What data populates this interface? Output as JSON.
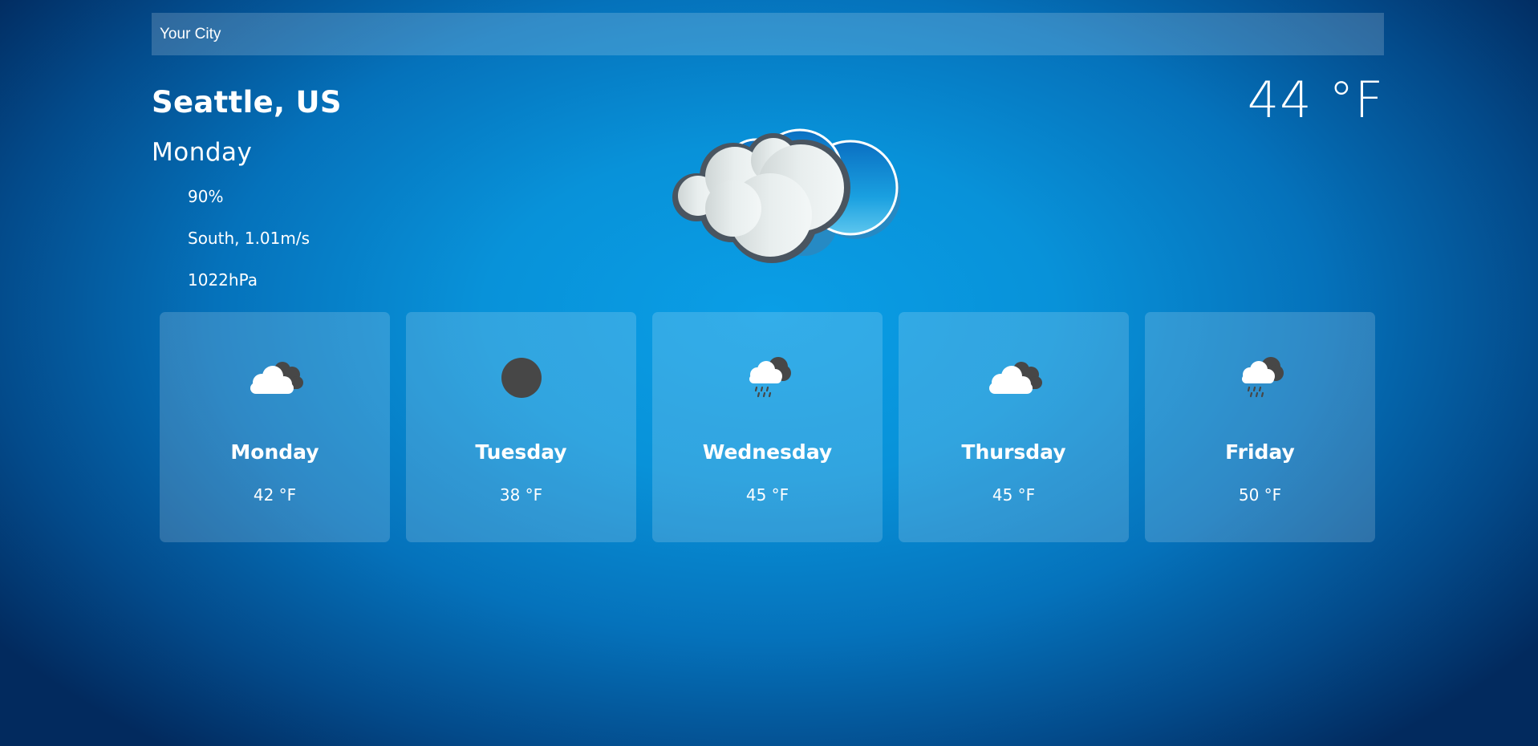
{
  "search": {
    "placeholder": "Your City"
  },
  "current": {
    "location": "Seattle, US",
    "day": "Monday",
    "temperature": "44 °F",
    "humidity": "90%",
    "wind": "South, 1.01m/s",
    "pressure": "1022hPa",
    "icon": "clouds-icon"
  },
  "forecast": [
    {
      "day": "Monday",
      "temp": "42 °F",
      "icon": "partly-cloudy-icon"
    },
    {
      "day": "Tuesday",
      "temp": "38 °F",
      "icon": "dark-circle-icon"
    },
    {
      "day": "Wednesday",
      "temp": "45 °F",
      "icon": "rain-cloud-icon"
    },
    {
      "day": "Thursday",
      "temp": "45 °F",
      "icon": "partly-cloudy-icon"
    },
    {
      "day": "Friday",
      "temp": "50 °F",
      "icon": "rain-cloud-icon"
    }
  ],
  "colors": {
    "background_center": "#0a9ee6",
    "background_edge": "#022a5e",
    "icon_dark": "#474747",
    "icon_light": "#ffffff"
  }
}
